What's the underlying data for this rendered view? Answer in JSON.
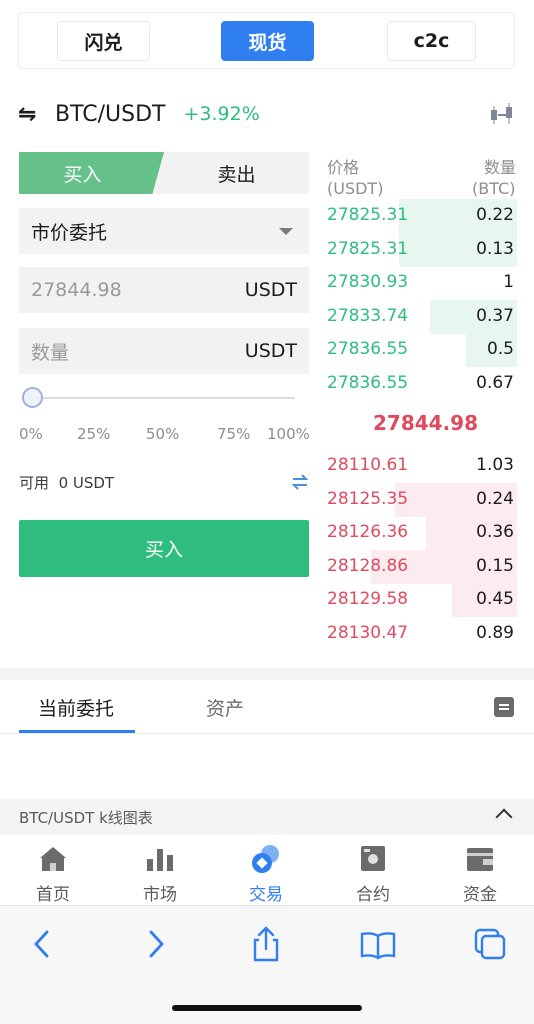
{
  "top_tabs": [
    {
      "label": "闪兑"
    },
    {
      "label": "现货"
    },
    {
      "label": "c2c"
    }
  ],
  "pair": {
    "name": "BTC/USDT",
    "change": "+3.92%"
  },
  "trade": {
    "buy_label": "买入",
    "sell_label": "卖出",
    "order_type": "市价委托",
    "price_value": "27844.98",
    "price_unit": "USDT",
    "amount_placeholder": "数量",
    "amount_unit": "USDT",
    "slider_level": 0,
    "percents": [
      "0%",
      "25%",
      "50%",
      "75%",
      "100%"
    ],
    "available_label": "可用",
    "available_value": "0 USDT",
    "buy_button": "买入"
  },
  "orderbook": {
    "price_header": "价格",
    "price_unit": "(USDT)",
    "qty_header": "数量",
    "qty_unit": "(BTC)",
    "bids": [
      {
        "price": "27825.31",
        "qty": "0.22",
        "depth": 0.62
      },
      {
        "price": "27825.31",
        "qty": "0.13",
        "depth": 0.62
      },
      {
        "price": "27830.93",
        "qty": "1",
        "depth": 0
      },
      {
        "price": "27833.74",
        "qty": "0.37",
        "depth": 0.46
      },
      {
        "price": "27836.55",
        "qty": "0.5",
        "depth": 0.27
      },
      {
        "price": "27836.55",
        "qty": "0.67",
        "depth": 0
      }
    ],
    "mid_price": "27844.98",
    "asks": [
      {
        "price": "28110.61",
        "qty": "1.03",
        "depth": 0
      },
      {
        "price": "28125.35",
        "qty": "0.24",
        "depth": 0.64
      },
      {
        "price": "28126.36",
        "qty": "0.36",
        "depth": 0.48
      },
      {
        "price": "28128.86",
        "qty": "0.15",
        "depth": 0.77
      },
      {
        "price": "28129.58",
        "qty": "0.45",
        "depth": 0.34
      },
      {
        "price": "28130.47",
        "qty": "0.89",
        "depth": 0
      }
    ]
  },
  "orders": {
    "tab_current": "当前委托",
    "tab_assets": "资产"
  },
  "kline_bar": "BTC/USDT k线图表",
  "nav": [
    {
      "label": "首页"
    },
    {
      "label": "市场"
    },
    {
      "label": "交易"
    },
    {
      "label": "合约"
    },
    {
      "label": "资金"
    }
  ],
  "colors": {
    "accent": "#2f7ff0",
    "up": "#2ebd7e",
    "down": "#e04a5e"
  }
}
